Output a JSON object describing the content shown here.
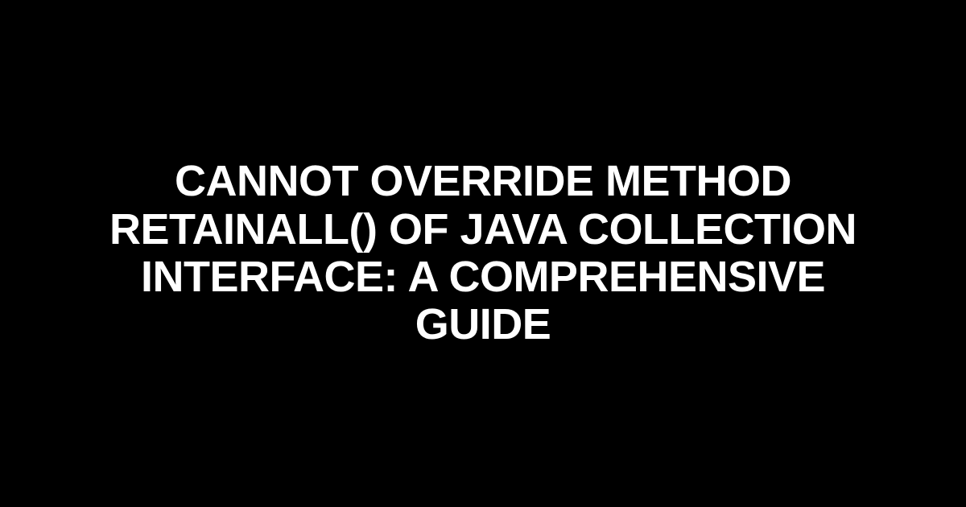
{
  "heading": {
    "text": "Cannot Override Method retainAll() of Java Collection Interface: A Comprehensive Guide"
  }
}
